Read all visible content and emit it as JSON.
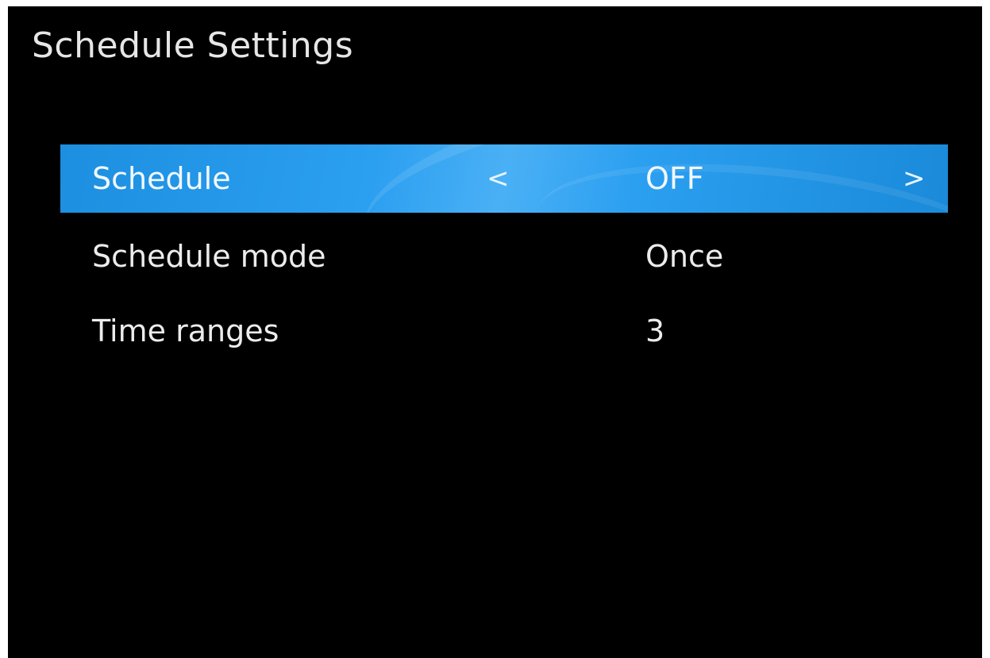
{
  "title": "Schedule Settings",
  "menu": {
    "items": [
      {
        "label": "Schedule",
        "value": "OFF",
        "selected": true,
        "left_arrow": "<",
        "right_arrow": ">"
      },
      {
        "label": "Schedule mode",
        "value": "Once",
        "selected": false
      },
      {
        "label": "Time ranges",
        "value": "3",
        "selected": false
      }
    ]
  },
  "colors": {
    "background": "#000000",
    "highlight": "#2b9ff0",
    "text": "#ececec"
  }
}
